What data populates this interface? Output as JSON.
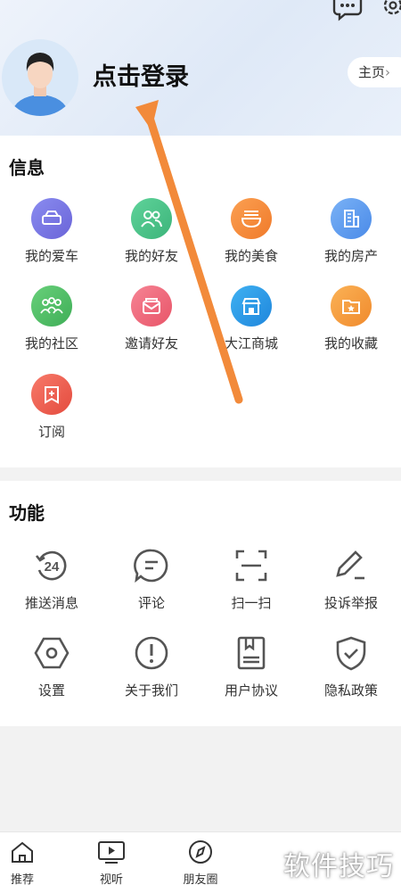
{
  "header": {
    "login_text": "点击登录",
    "home_button": "主页"
  },
  "info": {
    "title": "信息",
    "items": [
      {
        "label": "我的爱车",
        "icon": "car-icon",
        "color": "#7b79e6"
      },
      {
        "label": "我的好友",
        "icon": "friends-icon",
        "color": "#4cc38a"
      },
      {
        "label": "我的美食",
        "icon": "food-icon",
        "color": "#f58a3a"
      },
      {
        "label": "我的房产",
        "icon": "building-icon",
        "color": "#5b9cf0"
      },
      {
        "label": "我的社区",
        "icon": "community-icon",
        "color": "#4cc06a"
      },
      {
        "label": "邀请好友",
        "icon": "invite-icon",
        "color": "#f06a7a"
      },
      {
        "label": "大江商城",
        "icon": "shop-icon",
        "color": "#2f9be8"
      },
      {
        "label": "我的收藏",
        "icon": "favorite-icon",
        "color": "#f59a3a"
      },
      {
        "label": "订阅",
        "icon": "subscribe-icon",
        "color": "#f0604f"
      }
    ]
  },
  "functions": {
    "title": "功能",
    "items": [
      {
        "label": "推送消息",
        "icon": "push-24-icon"
      },
      {
        "label": "评论",
        "icon": "comment-icon"
      },
      {
        "label": "扫一扫",
        "icon": "scan-icon"
      },
      {
        "label": "投诉举报",
        "icon": "report-icon"
      },
      {
        "label": "设置",
        "icon": "settings-icon"
      },
      {
        "label": "关于我们",
        "icon": "about-icon"
      },
      {
        "label": "用户协议",
        "icon": "agreement-icon"
      },
      {
        "label": "隐私政策",
        "icon": "privacy-shield-icon"
      }
    ]
  },
  "bottom_nav": {
    "tabs": [
      {
        "label": "推荐",
        "icon": "home-icon"
      },
      {
        "label": "视听",
        "icon": "video-icon"
      },
      {
        "label": "朋友圈",
        "icon": "compass-icon"
      }
    ]
  },
  "watermark": "软件技巧",
  "colors": {
    "arrow": "#f28a3a",
    "line_icon": "#555555"
  }
}
